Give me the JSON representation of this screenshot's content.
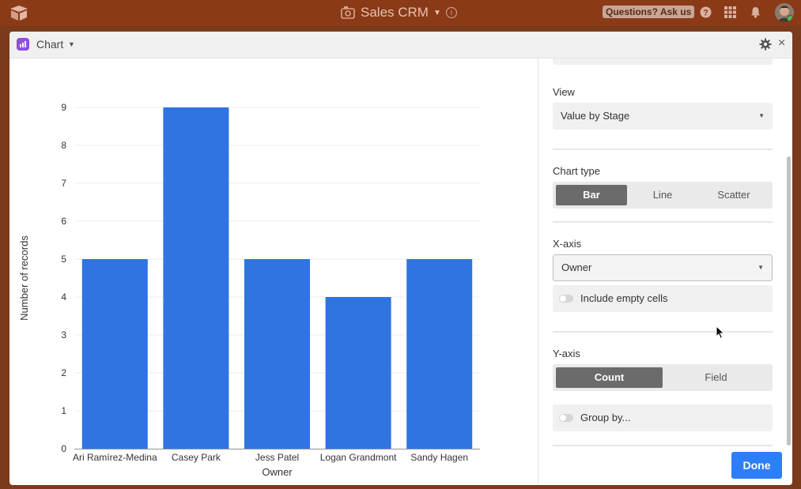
{
  "app": {
    "base_title": "Sales CRM",
    "questions_label": "Questions? Ask us",
    "icons": [
      "base-logo-icon",
      "base-emoji-icon",
      "chevron-down-icon",
      "info-icon",
      "help-icon",
      "apps-grid-icon",
      "bell-icon"
    ]
  },
  "dialog": {
    "title": "Chart",
    "close_symbol": "×",
    "icons": [
      "chart-app-icon",
      "chevron-down-icon",
      "gear-icon",
      "close-icon"
    ]
  },
  "panel": {
    "view_label": "View",
    "view_value": "Value by Stage",
    "chart_type_label": "Chart type",
    "chart_types": [
      "Bar",
      "Line",
      "Scatter"
    ],
    "chart_type_selected": "Bar",
    "x_axis_label": "X-axis",
    "x_axis_value": "Owner",
    "include_empty_label": "Include empty cells",
    "y_axis_label": "Y-axis",
    "y_axis_modes": [
      "Count",
      "Field"
    ],
    "y_axis_selected": "Count",
    "group_by_label": "Group by...",
    "done_label": "Done"
  },
  "chart_data": {
    "type": "bar",
    "categories": [
      "Ari Ramírez-Medina",
      "Casey Park",
      "Jess Patel",
      "Logan Grandmont",
      "Sandy Hagen"
    ],
    "values": [
      5,
      9,
      5,
      4,
      5
    ],
    "xlabel": "Owner",
    "ylabel": "Number of records",
    "ylim": [
      0,
      9
    ],
    "yticks": [
      0,
      1,
      2,
      3,
      4,
      5,
      6,
      7,
      8,
      9
    ],
    "grid": true,
    "bar_color": "#2f74e0"
  }
}
